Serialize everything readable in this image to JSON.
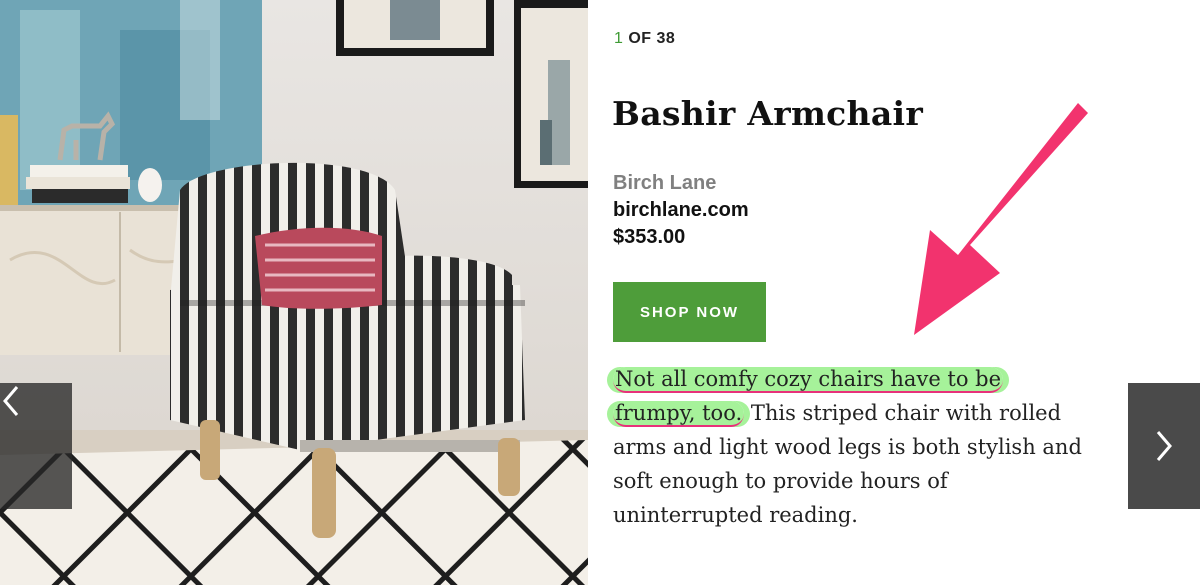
{
  "counter": {
    "current": "1",
    "rest": "OF 38"
  },
  "product": {
    "title": "Bashir Armchair",
    "brand": "Birch Lane",
    "site": "birchlane.com",
    "price": "$353.00"
  },
  "cta": {
    "label": "SHOP NOW"
  },
  "description": {
    "highlight_line1": "Not all comfy cozy chairs have to be",
    "highlight_line2": "frumpy, too.",
    "rest": " This striped chair with rolled arms and light wood legs is both stylish and soft enough to provide hours of uninterrupted reading."
  },
  "nav": {
    "prev_icon": "chevron-left-icon",
    "next_icon": "chevron-right-icon"
  },
  "colors": {
    "accent_green": "#4e9d3a",
    "highlight": "#a6f29a",
    "annotation_pink": "#f2336e"
  }
}
